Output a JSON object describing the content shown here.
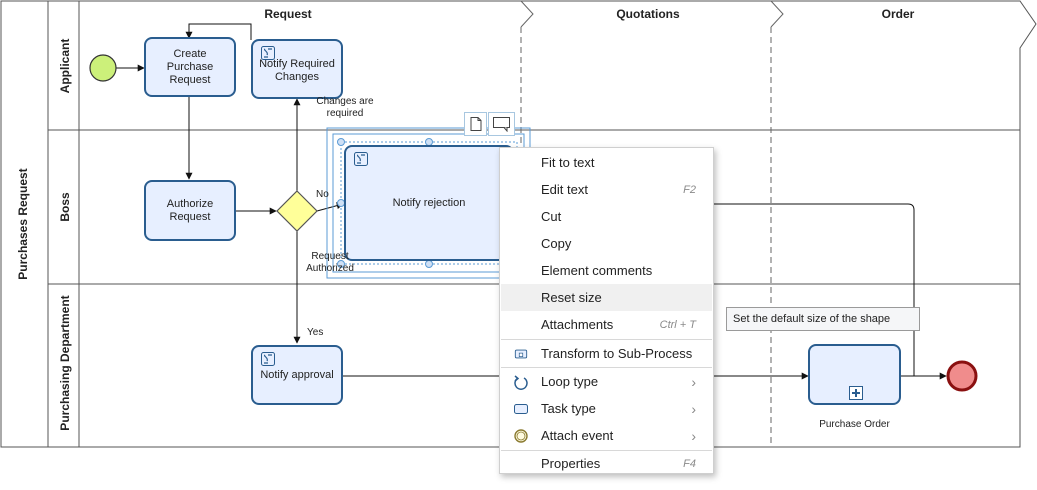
{
  "pool": {
    "title": "Purchases Request"
  },
  "stages": [
    "Request",
    "Quotations",
    "Order"
  ],
  "lanes": [
    "Applicant",
    "Boss",
    "Purchasing Department"
  ],
  "tasks": {
    "create_purchase_request": "Create Purchase Request",
    "notify_required_changes": "Notify Required Changes",
    "authorize_request": "Authorize Request",
    "notify_rejection": "Notify rejection",
    "notify_approval": "Notify approval",
    "purchase_order": "Purchase Order"
  },
  "flow_labels": {
    "changes_required": "Changes are required",
    "no": "No",
    "request_authorized": "Request Authorized",
    "yes": "Yes"
  },
  "context_menu": {
    "items": [
      {
        "label": "Fit to text",
        "shortcut": ""
      },
      {
        "label": "Edit text",
        "shortcut": "F2"
      },
      {
        "label": "Cut",
        "shortcut": ""
      },
      {
        "label": "Copy",
        "shortcut": ""
      },
      {
        "label": "Element comments",
        "shortcut": ""
      },
      {
        "label": "Reset size",
        "shortcut": ""
      },
      {
        "label": "Attachments",
        "shortcut": "Ctrl + T"
      },
      {
        "label": "Transform to Sub-Process",
        "icon": "subprocess-icon"
      },
      {
        "label": "Loop type",
        "icon": "loop-icon",
        "submenu": true
      },
      {
        "label": "Task type",
        "icon": "task-type-icon",
        "submenu": true
      },
      {
        "label": "Attach event",
        "icon": "event-icon",
        "submenu": true
      },
      {
        "label": "Properties",
        "shortcut": "F4"
      }
    ]
  },
  "tooltip": "Set the default size of the shape",
  "colors": {
    "task_border": "#2a5d8f",
    "task_fill": "#e7efff",
    "start_event": "#ccf07a",
    "end_event": "#f08c8c",
    "gateway": "#ffff99",
    "selection": "#5b9bd5"
  }
}
